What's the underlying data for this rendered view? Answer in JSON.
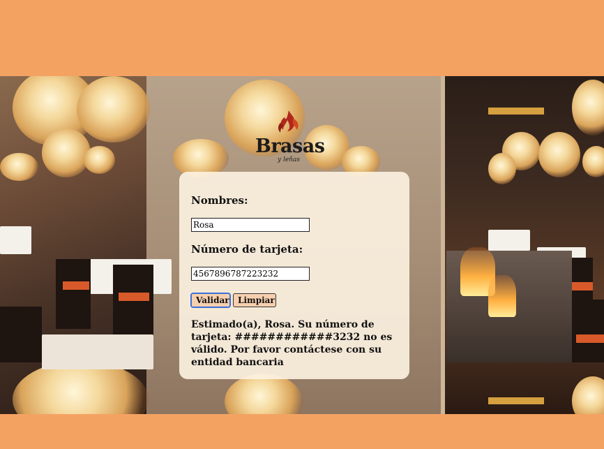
{
  "logo": {
    "brand": "Brasas",
    "tagline": "y leñas"
  },
  "form": {
    "name_label": "Nombres:",
    "name_value": "Rosa",
    "card_label": "Número de tarjeta:",
    "card_value": "4567896787223232",
    "validate_button": "Validar",
    "clear_button": "Limpiar",
    "message": "Estimado(a), Rosa. Su número de tarjeta: ############3232 no es válido. Por favor contáctese con su entidad bancaria"
  },
  "colors": {
    "page_background": "#f4a262",
    "panel_background": "#fdf3e2",
    "button_background": "#f6cfae",
    "focus_outline": "#3b6fd8"
  }
}
